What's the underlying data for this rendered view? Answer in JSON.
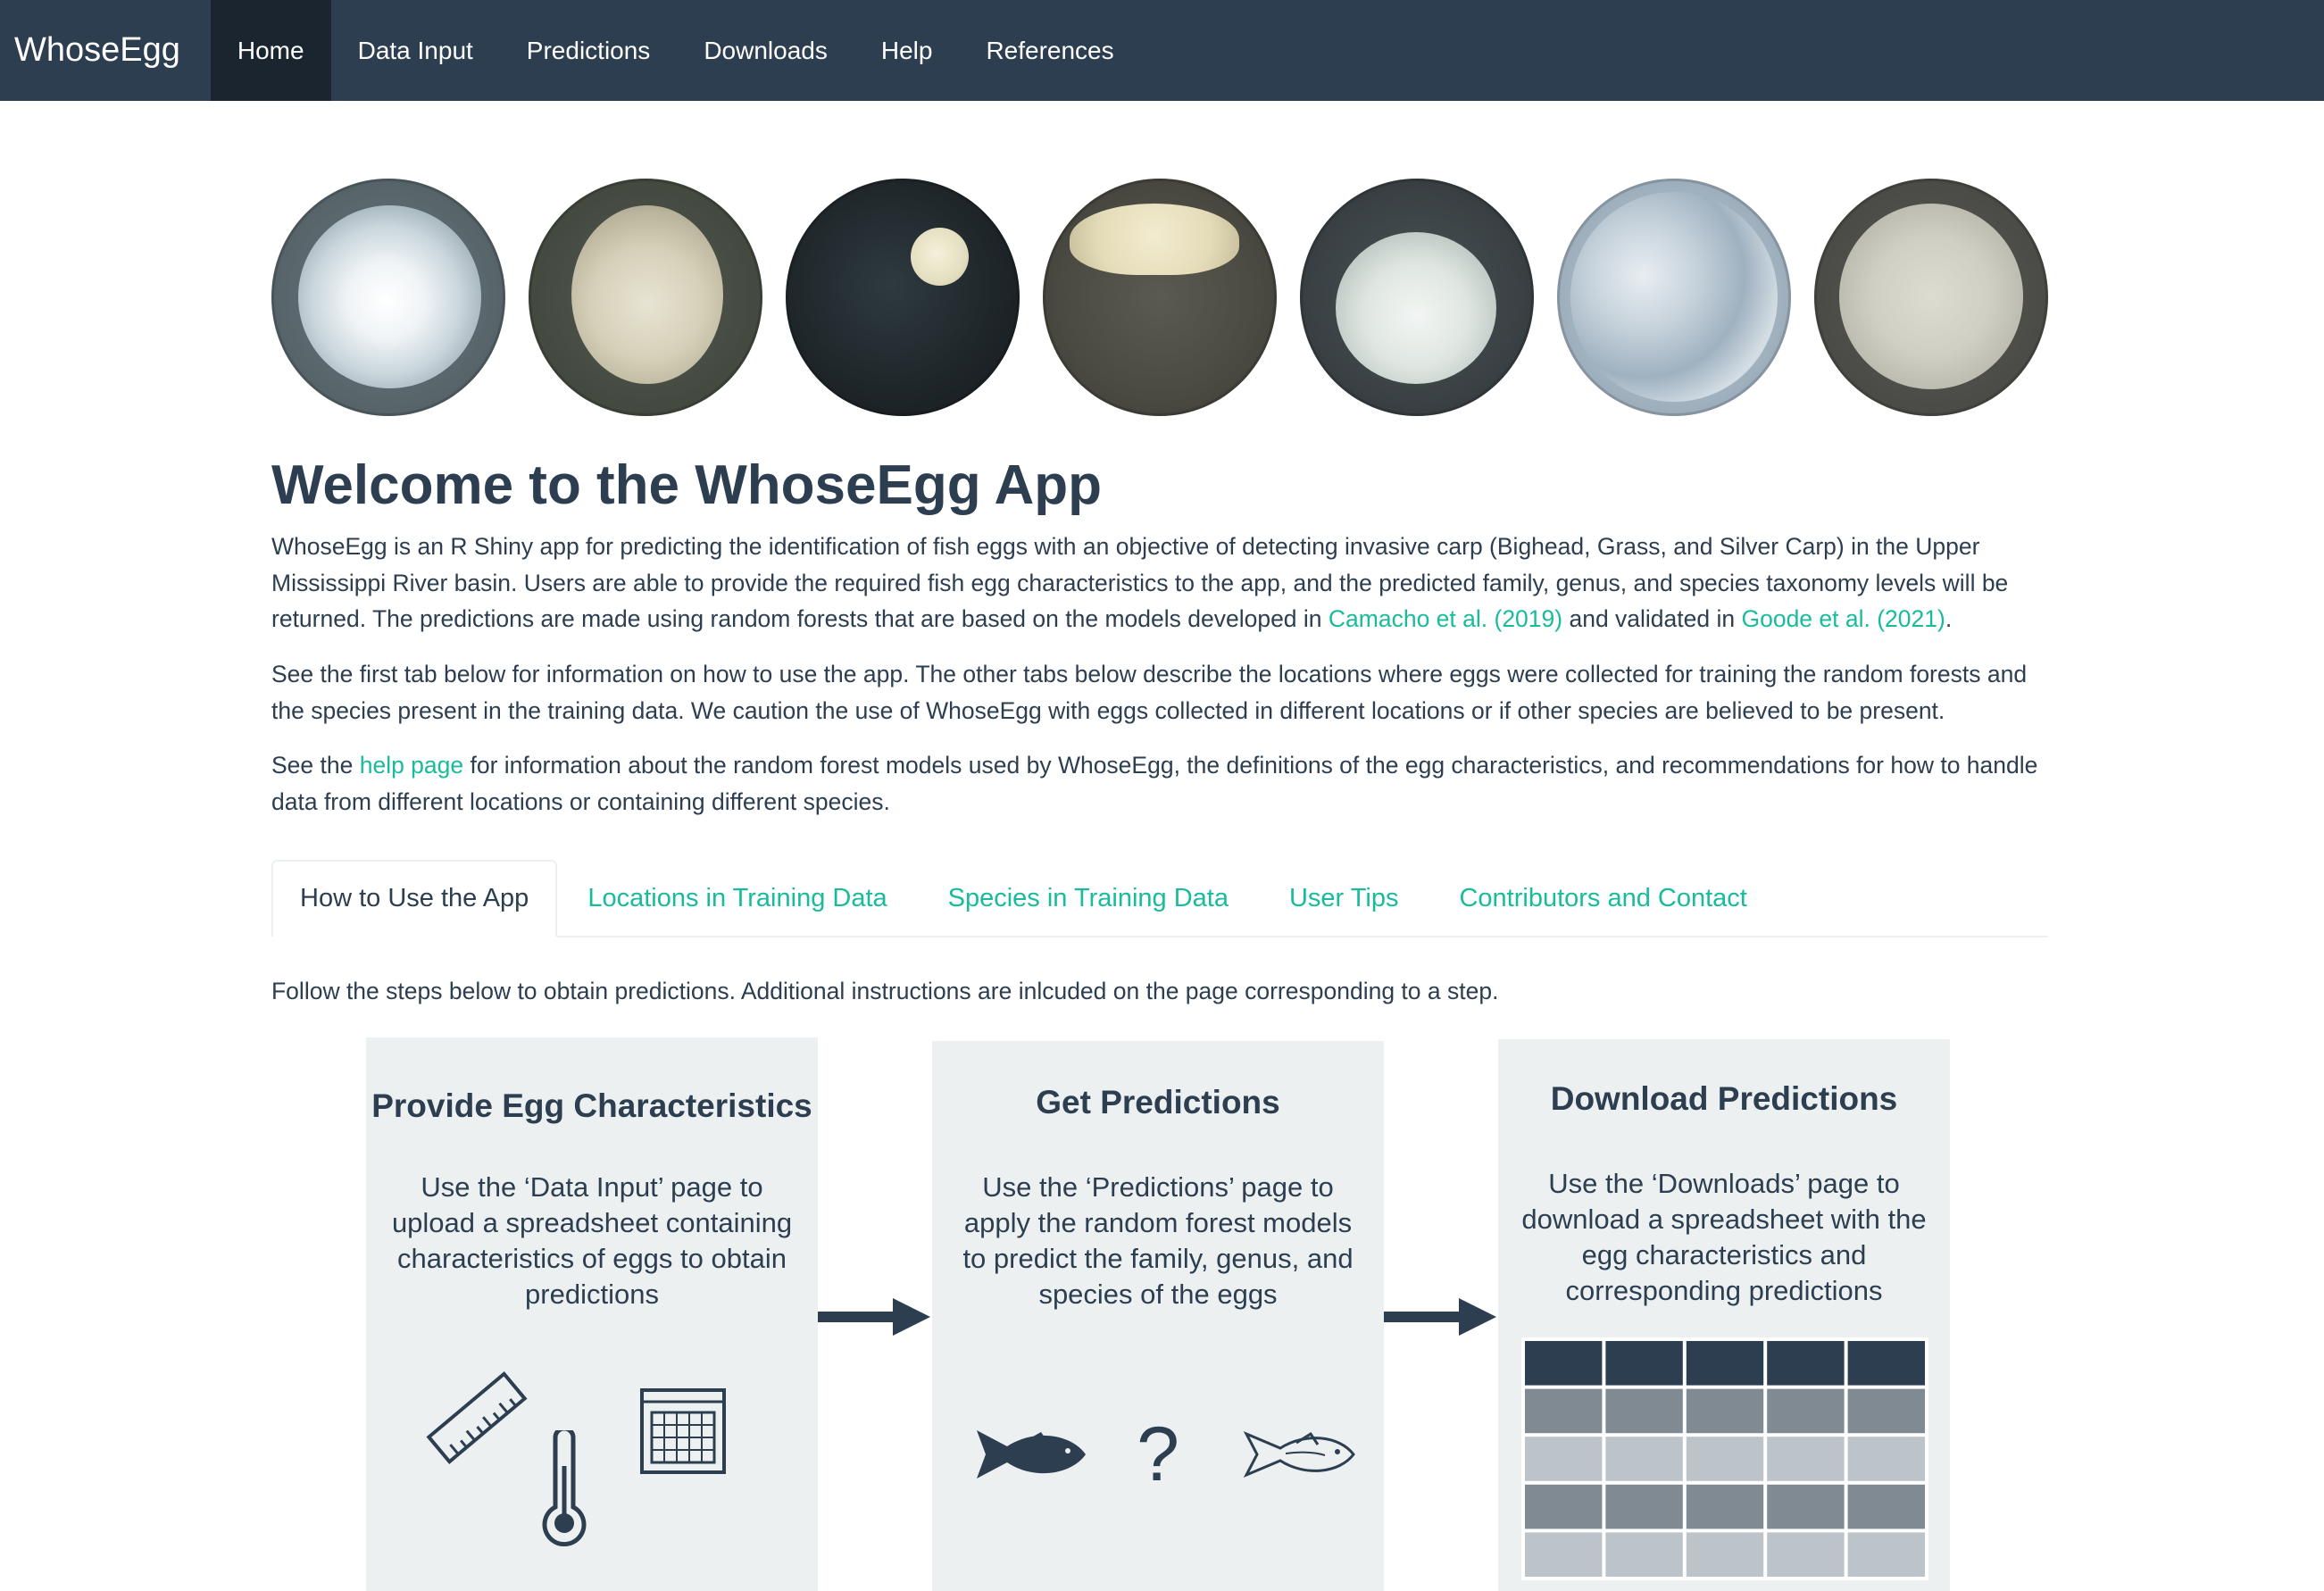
{
  "nav": {
    "brand": "WhoseEgg",
    "items": [
      "Home",
      "Data Input",
      "Predictions",
      "Downloads",
      "Help",
      "References"
    ],
    "active": "Home"
  },
  "page": {
    "title": "Welcome to the WhoseEgg App",
    "p1_before": "WhoseEgg is an R Shiny app for predicting the identification of fish eggs with an objective of detecting invasive carp (Bighead, Grass, and Silver Carp) in the Upper Mississippi River basin. Users are able to provide the required fish egg characteristics to the app, and the predicted family, genus, and species taxonomy levels will be returned. The predictions are made using random forests that are based on the models developed in ",
    "p1_link1": "Camacho et al. (2019)",
    "p1_mid": " and validated in ",
    "p1_link2": "Goode et al. (2021)",
    "p1_end": ".",
    "p2": "See the first tab below for information on how to use the app. The other tabs below describe the locations where eggs were collected for training the random forests and the species present in the training data. We caution the use of WhoseEgg with eggs collected in different locations or if other species are believed to be present.",
    "p3_before": "See the ",
    "p3_link": "help page",
    "p3_after": " for information about the random forest models used by WhoseEgg, the definitions of the egg characteristics, and recommendations for how to handle data from different locations or containing different species."
  },
  "tabs": [
    "How to Use the App",
    "Locations in Training Data",
    "Species in Training Data",
    "User Tips",
    "Contributors and Contact"
  ],
  "active_tab": "How to Use the App",
  "instructions": "Follow the steps below to obtain predictions. Additional instructions are inlcuded on the page corresponding to a step.",
  "steps": [
    {
      "title": "Provide Egg Characteristics",
      "text": "Use the ‘Data Input’ page to upload a spreadsheet containing characteristics of eggs to obtain predictions"
    },
    {
      "title": "Get Predictions",
      "text": "Use the ‘Predictions’ page to apply the random forest models to predict the family, genus, and species of the eggs",
      "question_mark": "?"
    },
    {
      "title": "Download Predictions",
      "text": "Use the ‘Downloads’ page to download a spreadsheet with the egg characteristics and corresponding predictions"
    }
  ],
  "icons": {
    "step1": [
      "ruler-icon",
      "thermometer-icon",
      "spreadsheet-icon"
    ],
    "step2": [
      "fish-solid-icon",
      "question-icon",
      "fish-outline-icon"
    ],
    "step3": [
      "table-icon"
    ]
  },
  "colors": {
    "navbar": "#2c3e50",
    "navbar_active": "#1a252f",
    "link": "#18bc9c",
    "text": "#2c3e50",
    "box": "#ecf0f1"
  }
}
